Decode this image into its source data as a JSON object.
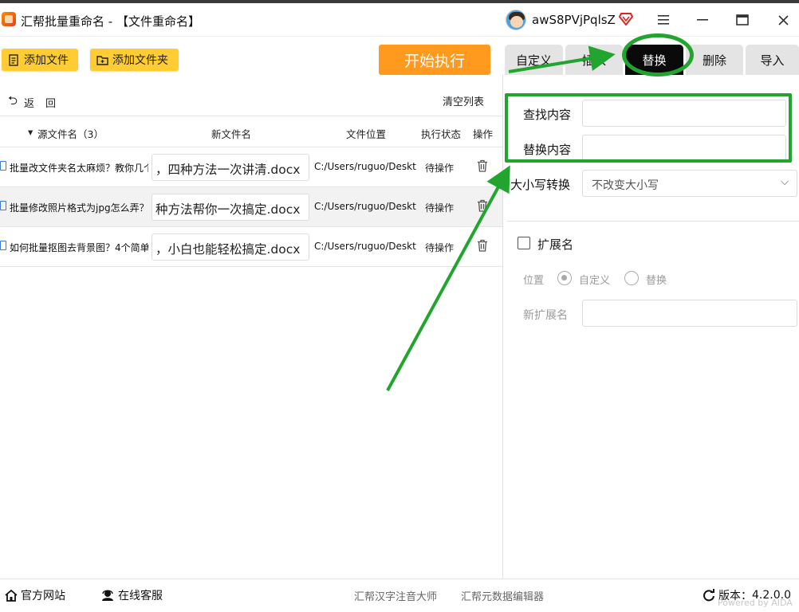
{
  "window": {
    "title": "汇帮批量重命名 - 【文件重命名】",
    "username": "awS8PVjPqlsZ",
    "minimize_icon": "minimize-icon",
    "maximize_icon": "maximize-icon",
    "close_icon": "close-icon",
    "menu_icon": "menu-icon"
  },
  "toolbar": {
    "add_file": "添加文件",
    "add_folder": "添加文件夹",
    "run": "开始执行"
  },
  "tabs": [
    {
      "label": "自定义",
      "active": false
    },
    {
      "label": "插入",
      "active": false
    },
    {
      "label": "替换",
      "active": true
    },
    {
      "label": "删除",
      "active": false
    },
    {
      "label": "导入",
      "active": false
    }
  ],
  "list": {
    "back": "返",
    "back2": "回",
    "clear": "清空列表",
    "headers": {
      "source": "源文件名（3）",
      "newname": "新文件名",
      "location": "文件位置",
      "status": "执行状态",
      "action": "操作"
    },
    "rows": [
      {
        "source": "批量改文件夹名太麻烦？教你几个",
        "newname": "，四种方法一次讲清.docx",
        "path": "C:/Users/ruguo/Desktop",
        "status": "待操作"
      },
      {
        "source": "批量修改照片格式为jpg怎么弄？",
        "newname": "种方法帮你一次搞定.docx",
        "path": "C:/Users/ruguo/Desktop",
        "status": "待操作"
      },
      {
        "source": "如何批量抠图去背景图？4个简单",
        "newname": "，小白也能轻松搞定.docx",
        "path": "C:/Users/ruguo/Desktop",
        "status": "待操作"
      }
    ]
  },
  "panel": {
    "find_label": "查找内容",
    "find_value": "",
    "replace_label": "替换内容",
    "replace_value": "",
    "case_label": "大小写转换",
    "case_value": "不改变大小写",
    "ext_label": "扩展名",
    "ext_checked": false,
    "position_label": "位置",
    "radio_custom": "自定义",
    "radio_replace": "替换",
    "new_ext_label": "新扩展名",
    "new_ext_value": ""
  },
  "footer": {
    "website": "官方网站",
    "support": "在线客服",
    "link1": "汇帮汉字注音大师",
    "link2": "汇帮元数据编辑器",
    "version_label": "版本：",
    "version": "4.2.0.0",
    "powered": "Powered by AIDA"
  },
  "colors": {
    "accent_orange": "#ff9a1f",
    "button_yellow": "#ffcc33",
    "annotation_green": "#22a52e",
    "active_tab": "#0a0a0a"
  }
}
